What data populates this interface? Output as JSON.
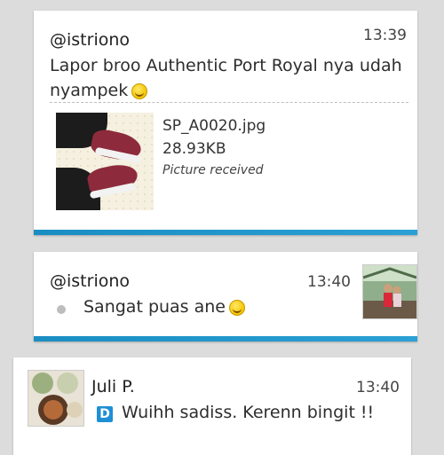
{
  "messages": [
    {
      "sender": "@istriono",
      "time": "13:39",
      "text": "Lapor broo Authentic Port Royal nya udah nyampek",
      "attachment": {
        "file_name": "SP_A0020.jpg",
        "file_size": "28.93KB",
        "status": "Picture received"
      }
    },
    {
      "sender": "@istriono",
      "time": "13:40",
      "text": "Sangat puas ane"
    },
    {
      "sender": "Juli P.",
      "time": "13:40",
      "badge": "D",
      "text": "Wuihh sadiss. Kerenn bingit !!"
    }
  ],
  "colors": {
    "background": "#dcdcdc",
    "bubble": "#ffffff",
    "accent_bar": "#1a8ec2",
    "badge": "#1f8fd6"
  }
}
